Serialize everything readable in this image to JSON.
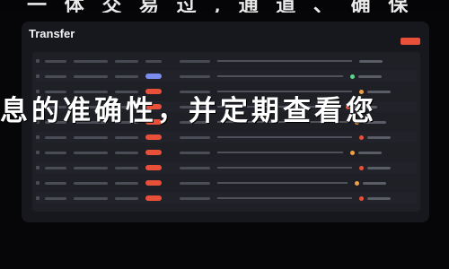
{
  "window": {
    "top_fragment": "一 体 交 易 过 , 通 道 、 确 保",
    "title": "Transfer",
    "primary_action_color": "#e8503a"
  },
  "table": {
    "rows": [
      {
        "type": "header"
      },
      {
        "type": "data",
        "pill": "blue",
        "status": "green"
      },
      {
        "type": "data",
        "pill": "red",
        "status": "orange"
      },
      {
        "type": "data",
        "pill": "red",
        "status": "red"
      },
      {
        "type": "data",
        "pill": "red",
        "status": "orange"
      },
      {
        "type": "data",
        "pill": "red",
        "status": "red"
      },
      {
        "type": "data",
        "pill": "red",
        "status": "orange"
      },
      {
        "type": "data",
        "pill": "red",
        "status": "red"
      },
      {
        "type": "data",
        "pill": "red",
        "status": "orange"
      },
      {
        "type": "data",
        "pill": "red",
        "status": "red"
      }
    ],
    "colors": {
      "blue": "#7c8df0",
      "red": "#e8503a",
      "green": "#5fd38d",
      "orange": "#f0a048"
    }
  },
  "overlay": {
    "text": "息的准确性，并定期查看您"
  }
}
